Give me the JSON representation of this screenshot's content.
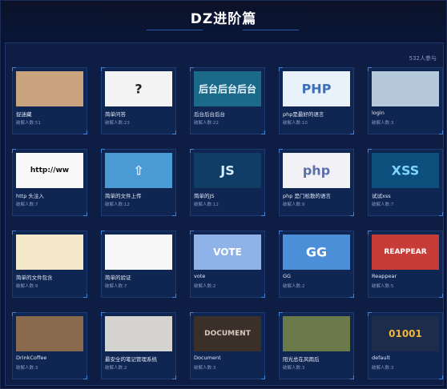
{
  "header": {
    "title": "DZ进阶篇"
  },
  "panel": {
    "participants": "532人参与"
  },
  "challenges": [
    {
      "name": "捉迷藏",
      "solves": "破解人数:51",
      "thumb": "girl-on-phone",
      "thumb_text": "",
      "thumb_bg": "#c9a27e",
      "text_color": "#ffffff"
    },
    {
      "name": "简单问答",
      "solves": "破解人数:23",
      "thumb": "question-marks",
      "thumb_text": "?",
      "thumb_bg": "#f4f4f4",
      "text_color": "#222222"
    },
    {
      "name": "后台后台后台",
      "solves": "破解人数:22",
      "thumb": "digital-tunnel",
      "thumb_text": "后台后台后台",
      "thumb_bg": "#1c6a8a",
      "text_color": "#e8f6ff"
    },
    {
      "name": "php是最好的语言",
      "solves": "破解人数:10",
      "thumb": "php-logo",
      "thumb_text": "PHP",
      "thumb_bg": "#e9f2fb",
      "text_color": "#3d6fb8"
    },
    {
      "name": "login",
      "solves": "破解人数:3",
      "thumb": "phone-hand",
      "thumb_text": "",
      "thumb_bg": "#b6c8dc",
      "text_color": "#ffffff"
    },
    {
      "name": "http 头注入",
      "solves": "破解人数:7",
      "thumb": "http-address",
      "thumb_text": "http://ww",
      "thumb_bg": "#f8f8f8",
      "text_color": "#111111"
    },
    {
      "name": "简单的文件上传",
      "solves": "破解人数:12",
      "thumb": "upload-folder",
      "thumb_text": "⇧",
      "thumb_bg": "#4a9ad4",
      "text_color": "#e9f4ff"
    },
    {
      "name": "简单的JS",
      "solves": "破解人数:12",
      "thumb": "js-code",
      "thumb_text": "JS",
      "thumb_bg": "#0f3d66",
      "text_color": "#d8ecff"
    },
    {
      "name": "php 是门松散的语言",
      "solves": "破解人数:9",
      "thumb": "php-elephant",
      "thumb_text": "php",
      "thumb_bg": "#f2f2f6",
      "text_color": "#5b6fa8"
    },
    {
      "name": "试试xss",
      "solves": "破解人数:7",
      "thumb": "xss-matrix",
      "thumb_text": "XSS",
      "thumb_bg": "#0d4f7c",
      "text_color": "#7fd4ff"
    },
    {
      "name": "简单的文件包含",
      "solves": "破解人数:9",
      "thumb": "file-stack",
      "thumb_text": "",
      "thumb_bg": "#f3e8c8",
      "text_color": "#333333"
    },
    {
      "name": "简单的验证",
      "solves": "破解人数:7",
      "thumb": "conan-cartoon",
      "thumb_text": "",
      "thumb_bg": "#f7f7f7",
      "text_color": "#222222"
    },
    {
      "name": "vote",
      "solves": "破解人数:2",
      "thumb": "vote-hand",
      "thumb_text": "VOTE",
      "thumb_bg": "#8fb2e8",
      "text_color": "#ffffff"
    },
    {
      "name": "GG",
      "solves": "破解人数:2",
      "thumb": "gg-blue",
      "thumb_text": "GG",
      "thumb_bg": "#4a8fd8",
      "text_color": "#ffffff"
    },
    {
      "name": "Reappear",
      "solves": "破解人数:5",
      "thumb": "reappear-red",
      "thumb_text": "REAPPEAR",
      "thumb_bg": "#c73c36",
      "text_color": "#ffffff"
    },
    {
      "name": "DrinkCoffee",
      "solves": "破解人数:3",
      "thumb": "coffee-cup",
      "thumb_text": "",
      "thumb_bg": "#8a6a4c",
      "text_color": "#ffffff"
    },
    {
      "name": "最安全的笔记管理系统",
      "solves": "破解人数:2",
      "thumb": "writing-hands",
      "thumb_text": "",
      "thumb_bg": "#d5d3d0",
      "text_color": "#333333"
    },
    {
      "name": "Document",
      "solves": "破解人数:3",
      "thumb": "document-dark",
      "thumb_text": "DOCUMENT",
      "thumb_bg": "#3b2f2a",
      "text_color": "#d7c9bb"
    },
    {
      "name": "阳光总在风雨后",
      "solves": "破解人数:3",
      "thumb": "sunset-trees",
      "thumb_text": "",
      "thumb_bg": "#6b7a4a",
      "text_color": "#ffffff"
    },
    {
      "name": "default",
      "solves": "破解人数:3",
      "thumb": "binary-digits",
      "thumb_text": "01001",
      "thumb_bg": "#1c2c4a",
      "text_color": "#f2b53a"
    }
  ]
}
